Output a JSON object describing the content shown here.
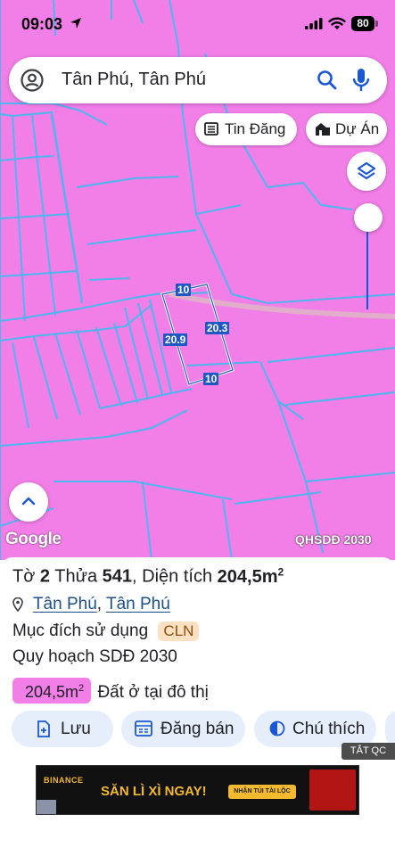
{
  "status_bar": {
    "time": "09:03",
    "battery": "80"
  },
  "search": {
    "query": "Tân Phú, Tân Phú"
  },
  "chips": [
    {
      "label": "Tin Đăng",
      "icon": "list-icon"
    },
    {
      "label": "Dự Án",
      "icon": "building-icon"
    }
  ],
  "map": {
    "logo": "Google",
    "layer_code": "QHSDĐ 2030",
    "base_color": "#f27ee8",
    "parcel_dimensions": {
      "top": "10",
      "bottom": "10",
      "left": "20.9",
      "right": "20.3"
    }
  },
  "parcel": {
    "sheet_label": "Tờ",
    "sheet_no": "2",
    "lot_label": "Thửa",
    "lot_no": "541",
    "area_label": "Diện tích",
    "area_value": "204,5m",
    "area_unit_sup": "2",
    "ward": "Tân Phú",
    "district": "Tân Phú",
    "purpose_label": "Mục đích sử dụng",
    "purpose_code": "CLN",
    "plan_label": "Quy hoạch SDĐ 2030",
    "plan_area": "204,5m",
    "plan_area_sup": "2",
    "plan_use": "Đất ở tại đô thị"
  },
  "actions": {
    "save": "Lưu",
    "post": "Đăng bán",
    "legend": "Chú thích"
  },
  "ad": {
    "tag": "TẮT QC",
    "brand": "BINANCE",
    "headline": "SĂN LÌ XÌ NGAY!",
    "cta": "NHẬN TÚI TÀI LỘC"
  },
  "colors": {
    "accent": "#1a57d6",
    "map_pink": "#f27ee8",
    "boundary": "#4fb5ef",
    "badge_bg": "#fbe0c2",
    "button_bg": "#e7eefb"
  }
}
